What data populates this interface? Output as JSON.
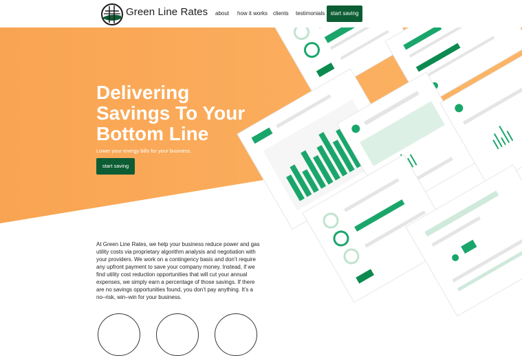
{
  "header": {
    "brand": "Green Line Rates",
    "nav": [
      "about",
      "how it works",
      "clients",
      "testimonials"
    ],
    "cta": "start saving"
  },
  "hero": {
    "title_lines": [
      "Delivering",
      "Savings To Your",
      "Bottom Line"
    ],
    "subtitle": "Lower your energy bills for your business.",
    "cta": "start saving"
  },
  "about": {
    "paragraph": "At Green Line Rates, we help your business reduce power and gas utility costs via proprietary algorithm analysis and negotiation with your providers.  We work on a contingency basis and don’t require any upfront payment to save your company money.  Instead, if we find utility cost reduction opportunities that will cut your annual expenses, we simply earn a percentage of those savings.  If there are no savings opportunities found, you don’t pay anything.  It’s a no–risk, win–win for your business."
  },
  "colors": {
    "orange": "#fca95b",
    "green": "#0d5d34",
    "accent_green": "#1aa66b"
  }
}
